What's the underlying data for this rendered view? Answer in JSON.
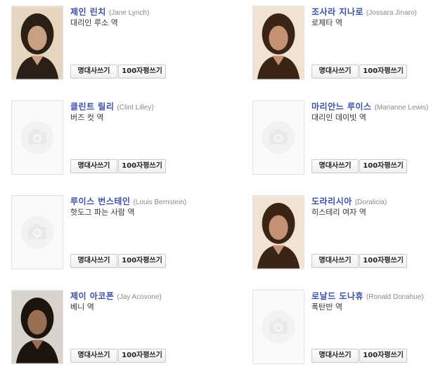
{
  "buttons": {
    "quote": "명대사쓰기",
    "review": "100자평쓰기"
  },
  "cast": [
    {
      "name": "제인 린치",
      "en": "(Jane Lynch)",
      "role": "대리인 루소 역",
      "photo": "actor-photo"
    },
    {
      "name": "조사라 지나로",
      "en": "(Jossara Jinaro)",
      "role": "로제타 역",
      "photo": "actor-photo"
    },
    {
      "name": "클린트 릴리",
      "en": "(Clint Lilley)",
      "role": "버즈 컷 역",
      "photo": "placeholder-camera"
    },
    {
      "name": "마리안느 루이스",
      "en": "(Marianne Lewis)",
      "role": "대리인 데이빗 역",
      "photo": "placeholder-camera"
    },
    {
      "name": "루이스 번스테인",
      "en": "(Louis Bernstein)",
      "role": "핫도그 파는 사람 역",
      "photo": "placeholder-camera"
    },
    {
      "name": "도라리시아",
      "en": "(Doralicia)",
      "role": "히스테리 여자 역",
      "photo": "actor-photo"
    },
    {
      "name": "제이 아코폰",
      "en": "(Jay Acovone)",
      "role": "베니 역",
      "photo": "actor-photo"
    },
    {
      "name": "로날드 도나휴",
      "en": "(Ronald Donahue)",
      "role": "폭탄반 역",
      "photo": "placeholder-camera"
    }
  ]
}
